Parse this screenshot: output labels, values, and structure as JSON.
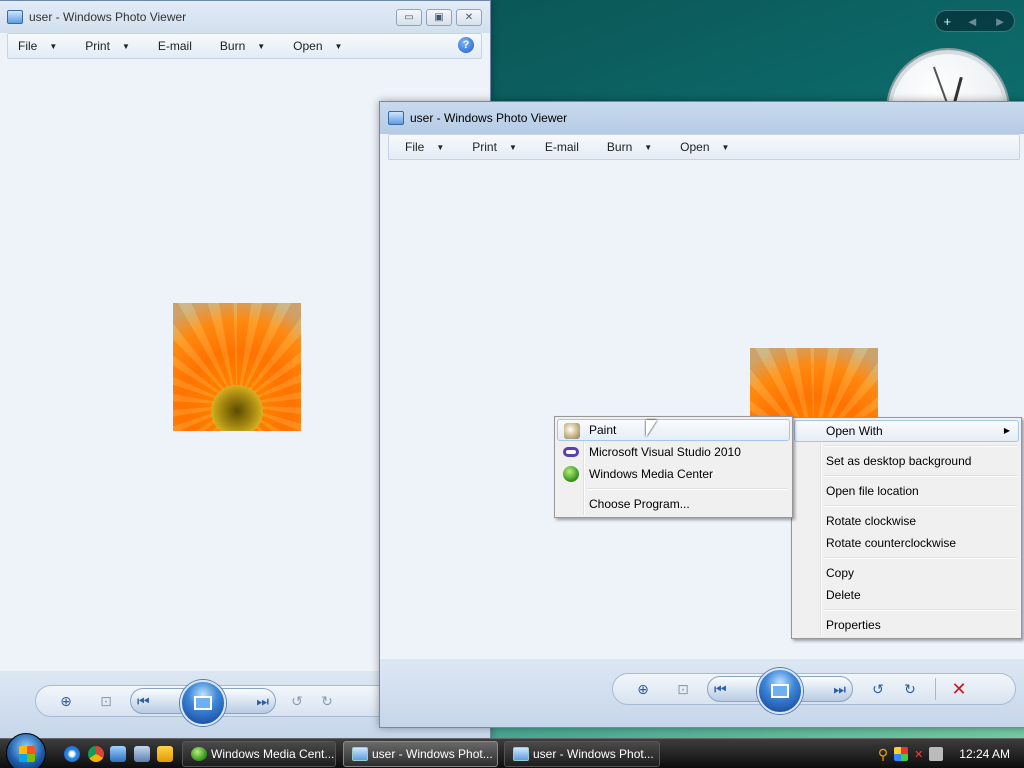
{
  "desktop": {
    "gadget_controls": {
      "add": "+",
      "prev": "◄",
      "next": "►"
    }
  },
  "back_window": {
    "title": "user - Windows Photo Viewer",
    "buttons": {
      "minimize": "▭",
      "maximize": "▣",
      "close": "✕"
    },
    "menu": [
      {
        "label": "File"
      },
      {
        "label": "Print"
      },
      {
        "label": "E-mail"
      },
      {
        "label": "Burn"
      },
      {
        "label": "Open"
      }
    ],
    "help": "?"
  },
  "front_window": {
    "title": "user - Windows Photo Viewer",
    "menu": [
      {
        "label": "File"
      },
      {
        "label": "Print"
      },
      {
        "label": "E-mail"
      },
      {
        "label": "Burn"
      },
      {
        "label": "Open"
      }
    ]
  },
  "controls": {
    "zoom": "⊕",
    "fit": "⊡",
    "previous": "⏮",
    "next": "⏭",
    "rotate_ccw": "↺",
    "rotate_cw": "↻",
    "delete": "✕"
  },
  "context_menu": {
    "items": [
      {
        "label": "Open With",
        "submenu_arrow": "▶"
      },
      {
        "label": "Set as desktop background"
      },
      {
        "label": "Open file location"
      },
      {
        "label": "Rotate clockwise"
      },
      {
        "label": "Rotate counterclockwise"
      },
      {
        "label": "Copy"
      },
      {
        "label": "Delete"
      },
      {
        "label": "Properties"
      }
    ]
  },
  "open_with_submenu": {
    "items": [
      {
        "label": "Paint",
        "icon": "paint-icon"
      },
      {
        "label": "Microsoft Visual Studio 2010",
        "icon": "visual-studio-icon"
      },
      {
        "label": "Windows Media Center",
        "icon": "media-center-icon"
      },
      {
        "label": "Choose Program..."
      }
    ]
  },
  "taskbar": {
    "buttons": [
      {
        "label": "Windows Media Cent...",
        "icon": "media-center-icon"
      },
      {
        "label": "user - Windows Phot...",
        "icon": "photo-viewer-icon"
      },
      {
        "label": "user - Windows Phot...",
        "icon": "photo-viewer-icon"
      }
    ],
    "clock": "12:24 AM",
    "tray_search": "⚲",
    "tray_alert": "✕"
  },
  "colors": {
    "accent": "#2b5da3",
    "delete_red": "#c8171e",
    "menu_highlight_border": "#a8c4e6"
  }
}
